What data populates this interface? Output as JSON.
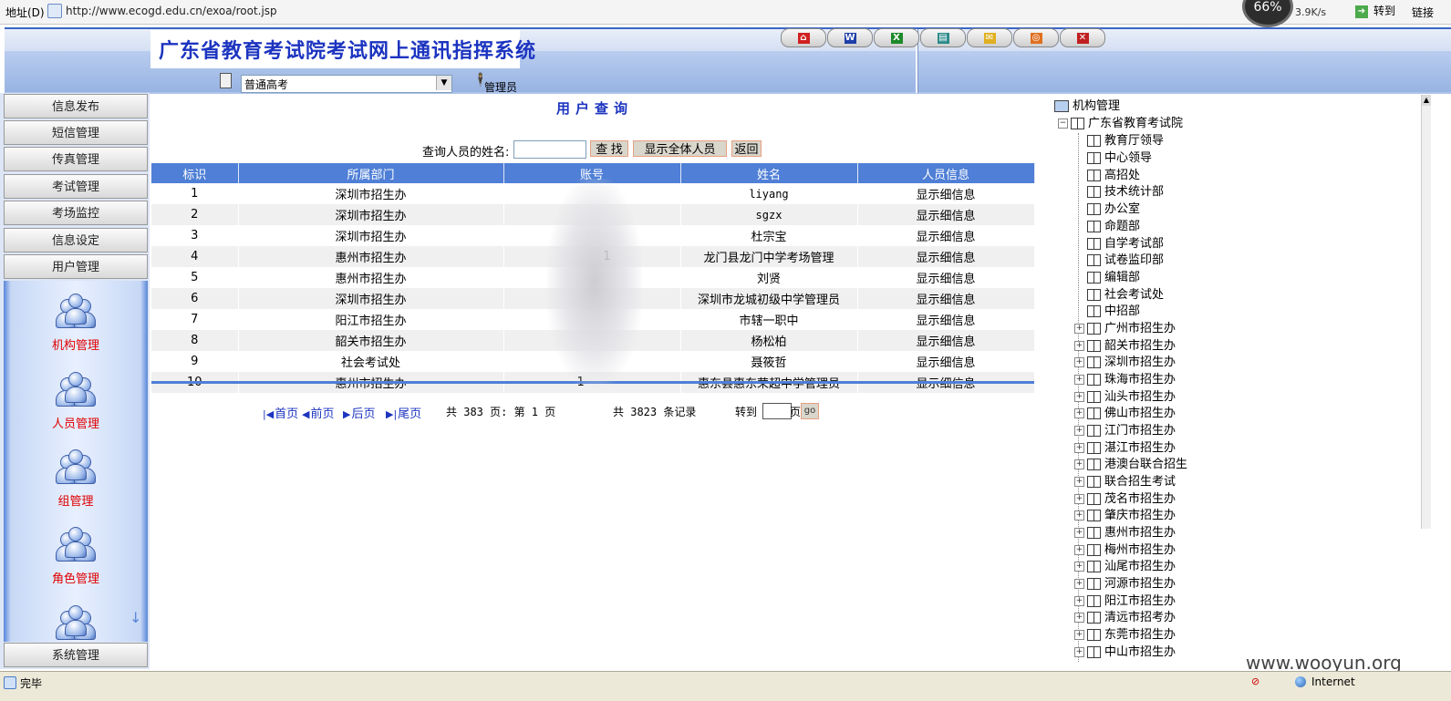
{
  "browser": {
    "address_label": "地址(D)",
    "url": "http://www.ecogd.edu.cn/exoa/root.jsp",
    "speed_percent": "66%",
    "speed_rate": "3.9K/s",
    "goto_label": "转到",
    "links_label": "链接"
  },
  "header": {
    "system_title": "广东省教育考试院考试网上通讯指挥系统",
    "exam_select_value": "普通高考",
    "user_role": "管理员",
    "toolbar_icons": [
      "home-icon",
      "word-icon",
      "excel-icon",
      "address-book-icon",
      "mail-icon",
      "help-icon",
      "exit-icon"
    ]
  },
  "sidebar": {
    "menu": [
      "信息发布",
      "短信管理",
      "传真管理",
      "考试管理",
      "考场监控",
      "信息设定",
      "用户管理"
    ],
    "submenu": [
      "机构管理",
      "人员管理",
      "组管理",
      "角色管理"
    ],
    "bottom": "系统管理"
  },
  "main": {
    "title": "用户查询",
    "search_label": "查询人员的姓名:",
    "search_value": "",
    "btn_search": "查 找",
    "btn_show_all": "显示全体人员",
    "btn_back": "返回",
    "columns": [
      "标识",
      "所属部门",
      "账号",
      "姓名",
      "人员信息"
    ],
    "rows": [
      {
        "id": "1",
        "dept": "深圳市招生办",
        "account": "",
        "name": "liyang",
        "info": "显示细信息"
      },
      {
        "id": "2",
        "dept": "深圳市招生办",
        "account": "",
        "name": "sgzx",
        "info": "显示细信息"
      },
      {
        "id": "3",
        "dept": "深圳市招生办",
        "account": "",
        "name": "杜宗宝",
        "info": "显示细信息"
      },
      {
        "id": "4",
        "dept": "惠州市招生办",
        "account": "1",
        "name": "龙门县龙门中学考场管理",
        "info": "显示细信息"
      },
      {
        "id": "5",
        "dept": "惠州市招生办",
        "account": "",
        "name": "刘贤",
        "info": "显示细信息"
      },
      {
        "id": "6",
        "dept": "深圳市招生办",
        "account": "",
        "name": "深圳市龙城初级中学管理员",
        "info": "显示细信息"
      },
      {
        "id": "7",
        "dept": "阳江市招生办",
        "account": "",
        "name": "市辖一职中",
        "info": "显示细信息"
      },
      {
        "id": "8",
        "dept": "韶关市招生办",
        "account": "",
        "name": "杨松柏",
        "info": "显示细信息"
      },
      {
        "id": "9",
        "dept": "社会考试处",
        "account": "",
        "name": "聂筱哲",
        "info": "显示细信息"
      },
      {
        "id": "10",
        "dept": "惠州市招生办",
        "account": "1",
        "name": "惠东县惠东荣超中学管理员",
        "info": "显示细信息"
      }
    ],
    "pager": {
      "first": "首页",
      "prev": "前页",
      "next": "后页",
      "last": "尾页",
      "pages_info": "共 383 页: 第 1 页",
      "records_info": "共 3823 条记录",
      "goto_label": "转到",
      "page_suffix": "页",
      "go_label": "go"
    }
  },
  "tree": {
    "root": "机构管理",
    "top_node": "广东省教育考试院",
    "children": [
      "教育厅领导",
      "中心领导",
      "高招处",
      "技术统计部",
      "办公室",
      "命题部",
      "自学考试部",
      "试卷监印部",
      "编辑部",
      "社会考试处",
      "中招部"
    ],
    "regions": [
      "广州市招生办",
      "韶关市招生办",
      "深圳市招生办",
      "珠海市招生办",
      "汕头市招生办",
      "佛山市招生办",
      "江门市招生办",
      "湛江市招生办",
      "港澳台联合招生",
      "联合招生考试",
      "茂名市招生办",
      "肇庆市招生办",
      "惠州市招生办",
      "梅州市招生办",
      "汕尾市招生办",
      "河源市招生办",
      "阳江市招生办",
      "清远市招考办",
      "东莞市招生办",
      "中山市招生办"
    ]
  },
  "watermark": "www.wooyun.org",
  "status": {
    "text": "完毕",
    "zone": "Internet"
  }
}
